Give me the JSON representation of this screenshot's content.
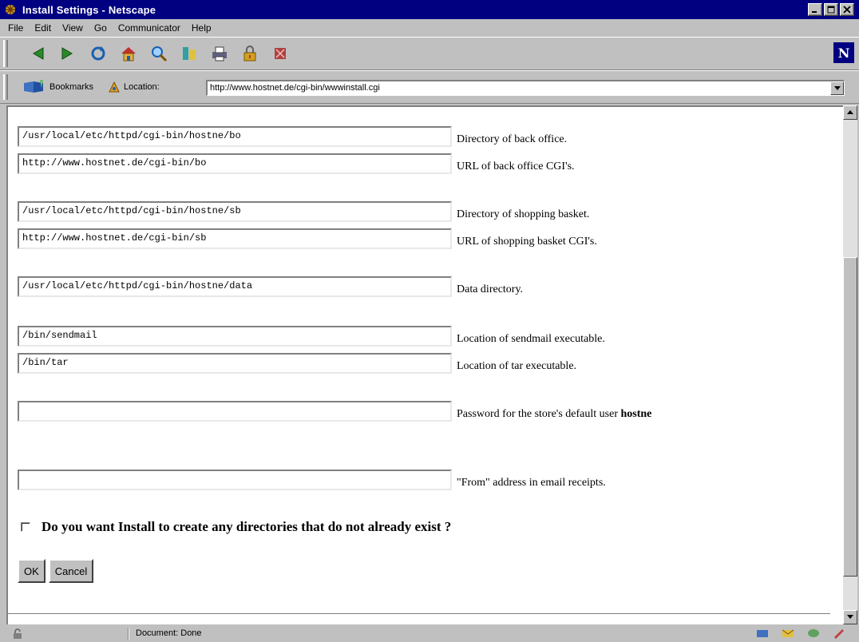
{
  "window": {
    "title": "Install Settings - Netscape",
    "buttons": {
      "minimize": "_",
      "maximize": "□",
      "close": "×"
    }
  },
  "menu": [
    {
      "label": "File",
      "accel": "F"
    },
    {
      "label": "Edit",
      "accel": "E"
    },
    {
      "label": "View",
      "accel": "V"
    },
    {
      "label": "Go",
      "accel": "G"
    },
    {
      "label": "Communicator",
      "accel": "C"
    },
    {
      "label": "Help",
      "accel": "H"
    }
  ],
  "toolbar": {
    "buttons": [
      "back-icon",
      "forward-icon",
      "reload-icon",
      "home-icon",
      "search-icon",
      "guide-icon",
      "print-icon",
      "security-icon",
      "stop-icon"
    ],
    "logo": "N"
  },
  "location": {
    "bookmarks_label": "Bookmarks",
    "location_label": "Location:",
    "url": "http://www.hostnet.de/cgi-bin/wwwinstall.cgi"
  },
  "form": {
    "fields": [
      {
        "value": "/usr/local/etc/httpd/cgi-bin/hostne/bo",
        "label": "Directory of back office."
      },
      {
        "value": "http://www.hostnet.de/cgi-bin/bo",
        "label": "URL of back office CGI's."
      },
      {
        "value": "/usr/local/etc/httpd/cgi-bin/hostne/sb",
        "label": "Directory of shopping basket."
      },
      {
        "value": "http://www.hostnet.de/cgi-bin/sb",
        "label": "URL of shopping basket CGI's."
      },
      {
        "value": "/usr/local/etc/httpd/cgi-bin/hostne/data",
        "label": "Data directory."
      },
      {
        "value": "/bin/sendmail",
        "label": "Location of sendmail executable."
      },
      {
        "value": "/bin/tar",
        "label": "Location of tar executable."
      },
      {
        "value": "",
        "label": "Password for the store's default user ",
        "label_bold": "hostne"
      },
      {
        "value": "",
        "label": "\"From\" address in email receipts."
      }
    ],
    "checkbox_label": "Do you want Install to create any directories that do not already exist ?",
    "ok_label": "OK",
    "cancel_label": "Cancel"
  },
  "status": {
    "text": "Document: Done"
  },
  "colors": {
    "titlebar": "#000080",
    "chrome": "#c0c0c0"
  }
}
